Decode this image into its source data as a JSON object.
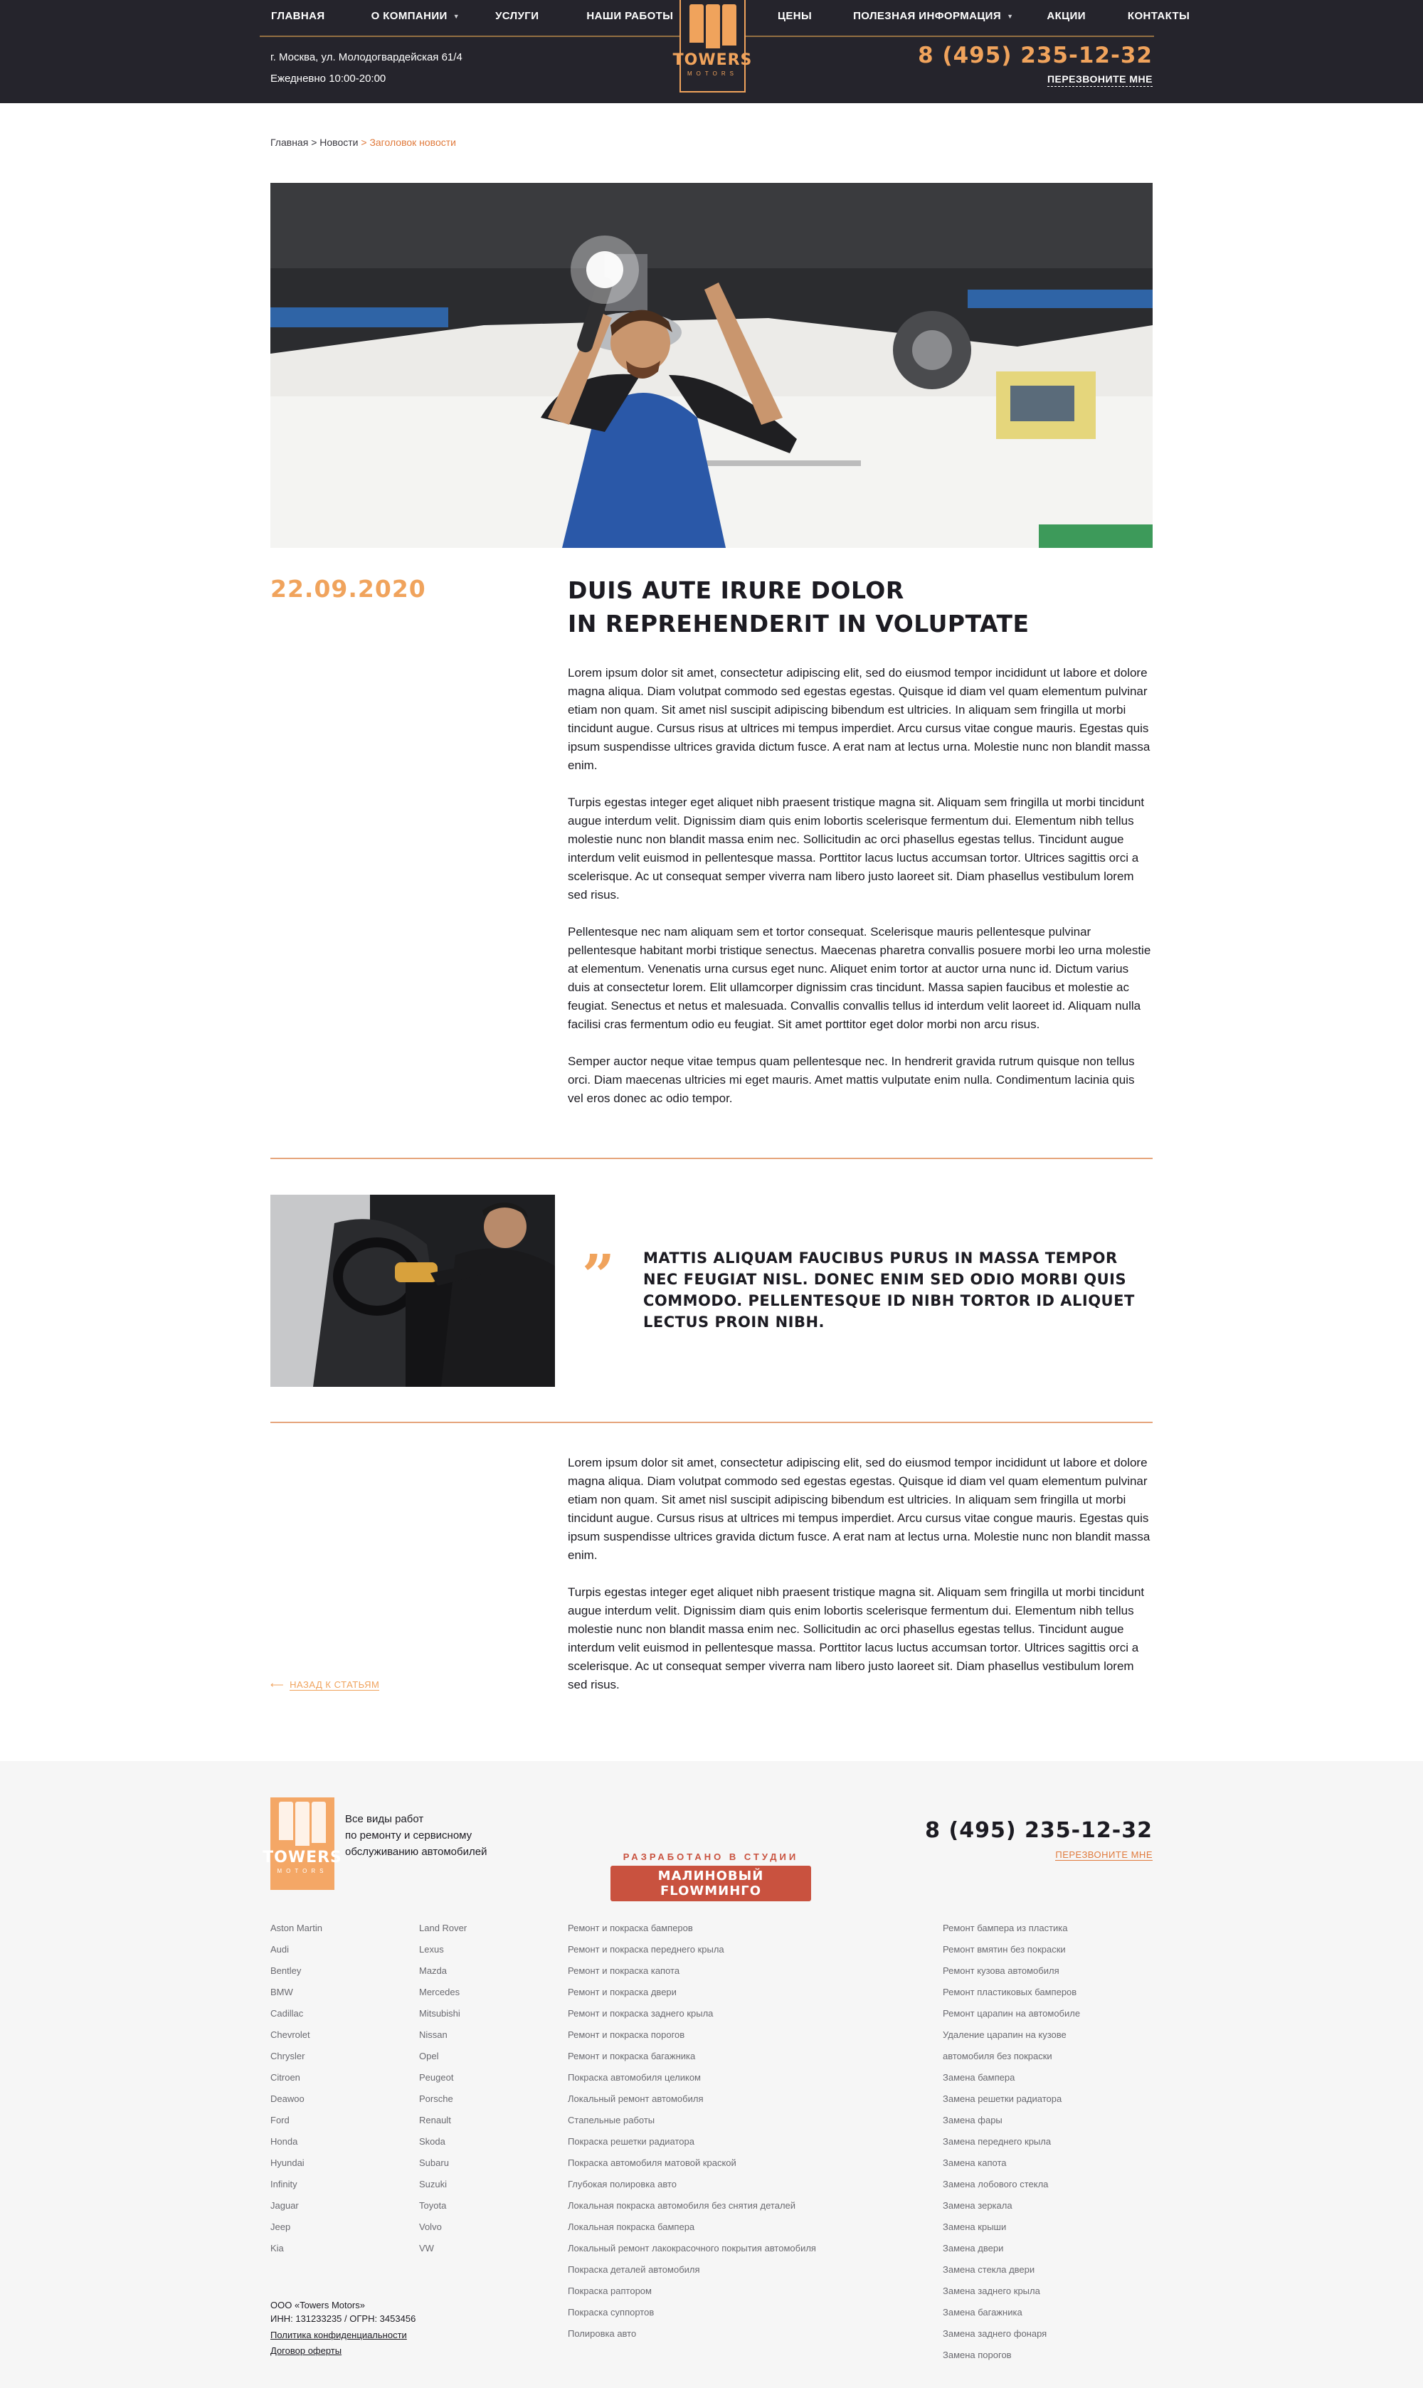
{
  "header": {
    "nav_left": [
      {
        "label": "ГЛАВНАЯ",
        "dropdown": false
      },
      {
        "label": "О КОМПАНИИ",
        "dropdown": true
      },
      {
        "label": "УСЛУГИ",
        "dropdown": false
      },
      {
        "label": "НАШИ РАБОТЫ",
        "dropdown": false
      }
    ],
    "nav_right": [
      {
        "label": "ЦЕНЫ",
        "dropdown": false
      },
      {
        "label": "ПОЛЕЗНАЯ ИНФОРМАЦИЯ",
        "dropdown": true
      },
      {
        "label": "АКЦИИ",
        "dropdown": false
      },
      {
        "label": "КОНТАКТЫ",
        "dropdown": false
      }
    ],
    "address": "г. Москва, ул. Молодогвардейская 61/4",
    "hours": "Ежедневно 10:00-20:00",
    "phone": "8 (495) 235-12-32",
    "callback": "ПЕРЕЗВОНИТЕ МНЕ",
    "logo_word": "TOWERS",
    "logo_sub": "MOTORS"
  },
  "breadcrumb": {
    "home": "Главная",
    "news": "Новости",
    "current": "Заголовок новости",
    "separator": ">"
  },
  "article": {
    "date": "22.09.2020",
    "title_line1": "DUIS AUTE IRURE DOLOR",
    "title_line2": "IN REPREHENDERIT IN VOLUPTATE",
    "paragraphs_top": [
      "Lorem ipsum dolor sit amet, consectetur adipiscing elit, sed do eiusmod tempor incididunt ut labore et dolore magna aliqua. Diam volutpat commodo sed egestas egestas. Quisque id diam vel quam elementum pulvinar etiam non quam. Sit amet nisl suscipit adipiscing bibendum est ultricies. In aliquam sem fringilla ut morbi tincidunt augue. Cursus risus at ultrices mi tempus imperdiet. Arcu cursus vitae congue mauris. Egestas quis ipsum suspendisse ultrices gravida dictum fusce. A erat nam at lectus urna. Molestie nunc non blandit massa enim.",
      "Turpis egestas integer eget aliquet nibh praesent tristique magna sit. Aliquam sem fringilla ut morbi tincidunt augue interdum velit. Dignissim diam quis enim lobortis scelerisque fermentum dui. Elementum nibh tellus molestie nunc non blandit massa enim nec. Sollicitudin ac orci phasellus egestas tellus. Tincidunt augue interdum velit euismod in pellentesque massa. Porttitor lacus luctus accumsan tortor. Ultrices sagittis orci a scelerisque. Ac ut consequat semper viverra nam libero justo laoreet sit. Diam phasellus vestibulum lorem sed risus.",
      "Pellentesque nec nam aliquam sem et tortor consequat. Scelerisque mauris pellentesque pulvinar pellentesque habitant morbi tristique senectus. Maecenas pharetra convallis posuere morbi leo urna molestie at elementum. Venenatis urna cursus eget nunc. Aliquet enim tortor at auctor urna nunc id. Dictum varius duis at consectetur lorem. Elit ullamcorper dignissim cras tincidunt. Massa sapien faucibus et molestie ac feugiat. Senectus et netus et malesuada. Convallis convallis tellus id interdum velit laoreet id. Aliquam nulla facilisi cras fermentum odio eu feugiat. Sit amet porttitor eget dolor morbi non arcu risus.",
      "Semper auctor neque vitae tempus quam pellentesque nec. In hendrerit gravida rutrum quisque non tellus orci. Diam maecenas ultricies mi eget mauris. Amet mattis vulputate enim nulla. Condimentum lacinia quis vel eros donec ac odio tempor."
    ],
    "quote_mark": "”",
    "quote": "MATTIS ALIQUAM FAUCIBUS PURUS IN MASSA TEMPOR NEC FEUGIAT NISL. DONEC ENIM SED ODIO MORBI QUIS COMMODO. PELLENTESQUE ID NIBH TORTOR ID ALIQUET LECTUS PROIN NIBH.",
    "paragraphs_bottom": [
      "Lorem ipsum dolor sit amet, consectetur adipiscing elit, sed do eiusmod tempor incididunt ut labore et dolore magna aliqua. Diam volutpat commodo sed egestas egestas. Quisque id diam vel quam elementum pulvinar etiam non quam. Sit amet nisl suscipit adipiscing bibendum est ultricies. In aliquam sem fringilla ut morbi tincidunt augue. Cursus risus at ultrices mi tempus imperdiet. Arcu cursus vitae congue mauris. Egestas quis ipsum suspendisse ultrices gravida dictum fusce. A erat nam at lectus urna. Molestie nunc non blandit massa enim.",
      "Turpis egestas integer eget aliquet nibh praesent tristique magna sit. Aliquam sem fringilla ut morbi tincidunt augue interdum velit. Dignissim diam quis enim lobortis scelerisque fermentum dui. Elementum nibh tellus molestie nunc non blandit massa enim nec. Sollicitudin ac orci phasellus egestas tellus. Tincidunt augue interdum velit euismod in pellentesque massa. Porttitor lacus luctus accumsan tortor. Ultrices sagittis orci a scelerisque. Ac ut consequat semper viverra nam libero justo laoreet sit. Diam phasellus vestibulum lorem sed risus."
    ],
    "back_arrow": "⟵",
    "back_label": "НАЗАД К СТАТЬЯМ"
  },
  "footer": {
    "logo_word": "TOWERS",
    "logo_sub": "MOTORS",
    "desc_line1": "Все виды работ",
    "desc_line2": "по ремонту и сервисному",
    "desc_line3": "обслуживанию автомобилей",
    "studio_caption": "РАЗРАБОТАНО В СТУДИИ",
    "studio_name": "МАЛИНОВЫЙ FLOWМИНГО",
    "phone": "8 (495) 235-12-32",
    "callback": "ПЕРЕЗВОНИТЕ МНЕ",
    "brands_col1": [
      "Aston Martin",
      "Audi",
      "Bentley",
      "BMW",
      "Cadillac",
      "Chevrolet",
      "Chrysler",
      "Citroen",
      "Deawoo",
      "Ford",
      "Honda",
      "Hyundai",
      "Infinity",
      "Jaguar",
      "Jeep",
      "Kia"
    ],
    "brands_col2": [
      "Land Rover",
      "Lexus",
      "Mazda",
      "Mercedes",
      "Mitsubishi",
      "Nissan",
      "Opel",
      "Peugeot",
      "Porsche",
      "Renault",
      "Skoda",
      "Subaru",
      "Suzuki",
      "Toyota",
      "Volvo",
      "VW"
    ],
    "services_col1": [
      "Ремонт и покраска бамперов",
      "Ремонт и покраска переднего крыла",
      "Ремонт и покраска капота",
      "Ремонт и покраска двери",
      "Ремонт и покраска заднего крыла",
      "Ремонт и покраска порогов",
      "Ремонт и покраска багажника",
      "Покраска автомобиля целиком",
      "Локальный ремонт автомобиля",
      "Стапельные работы",
      "Покраска решетки радиатора",
      "Покраска автомобиля матовой краской",
      "Глубокая полировка авто",
      "Локальная покраска автомобиля без снятия деталей",
      "Локальная покраска бампера",
      "Локальный ремонт лакокрасочного покрытия автомобиля",
      "Покраска деталей автомобиля",
      "Покраска раптором",
      "Покраска суппортов",
      "Полировка авто"
    ],
    "services_col2": [
      "Ремонт бампера из пластика",
      "Ремонт вмятин без покраски",
      "Ремонт кузова автомобиля",
      "Ремонт пластиковых бамперов",
      "Ремонт царапин на автомобиле",
      "Удаление царапин на кузове",
      "автомобиля без покраски",
      "Замена бампера",
      "Замена решетки радиатора",
      "Замена фары",
      "Замена переднего крыла",
      "Замена капота",
      "Замена лобового стекла",
      "Замена зеркала",
      "Замена крыши",
      "Замена двери",
      "Замена стекла двери",
      "Замена заднего крыла",
      "Замена багажника",
      "Замена заднего фонаря",
      "Замена порогов"
    ],
    "company": "ООО «Towers Motors»",
    "inn": "ИНН: 131233235 / ОГРН: 3453456",
    "privacy": "Политика конфиденциальности",
    "offer": "Договор оферты"
  }
}
